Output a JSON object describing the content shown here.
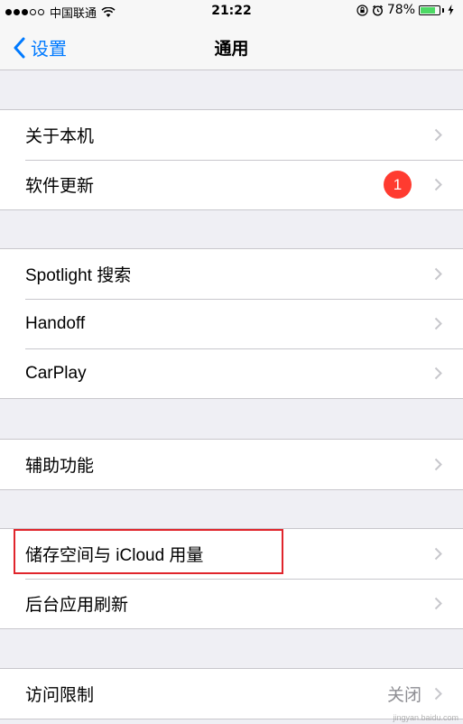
{
  "status_bar": {
    "carrier": "中国联通",
    "time": "21:22",
    "battery_percent": "78%",
    "battery_level": 0.78
  },
  "nav": {
    "back_label": "设置",
    "title": "通用"
  },
  "groups": [
    {
      "items": [
        {
          "label": "关于本机"
        },
        {
          "label": "软件更新",
          "badge": "1"
        }
      ]
    },
    {
      "items": [
        {
          "label": "Spotlight 搜索"
        },
        {
          "label": "Handoff"
        },
        {
          "label": "CarPlay"
        }
      ]
    },
    {
      "items": [
        {
          "label": "辅助功能"
        }
      ]
    },
    {
      "items": [
        {
          "label": "储存空间与 iCloud 用量"
        },
        {
          "label": "后台应用刷新"
        }
      ]
    },
    {
      "items": [
        {
          "label": "访问限制",
          "value": "关闭"
        }
      ]
    }
  ],
  "watermark": "jingyan.baidu.com",
  "colors": {
    "accent": "#007aff",
    "badge": "#ff3b30",
    "highlight": "#e0252c",
    "battery": "#4cd964"
  }
}
